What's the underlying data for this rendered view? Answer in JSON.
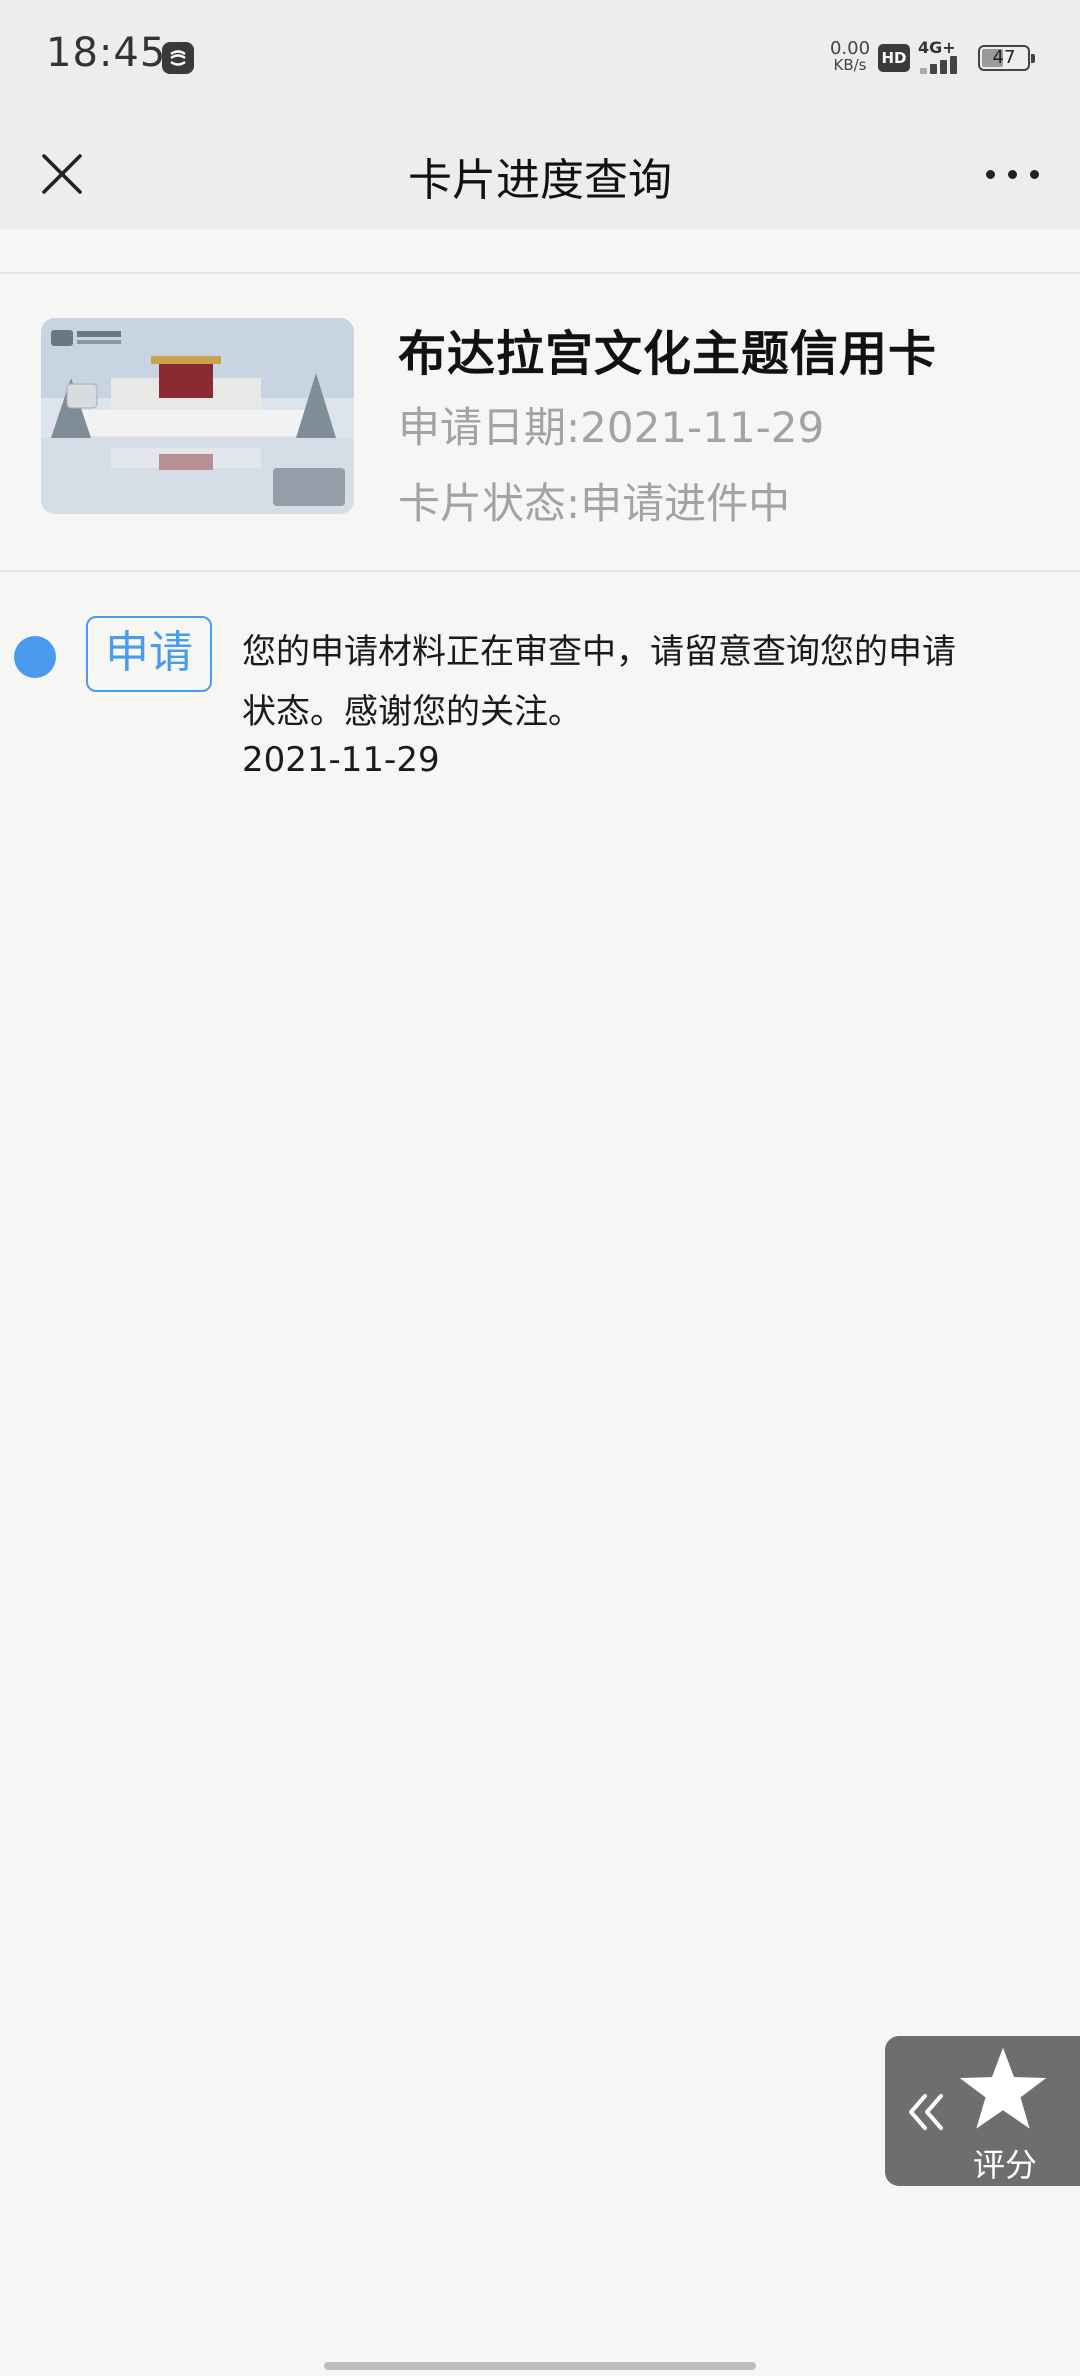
{
  "status_bar": {
    "time": "18:45",
    "net_speed_value": "0.00",
    "net_speed_unit": "KB/s",
    "hd_label": "HD",
    "signal_label": "4G+",
    "battery_level": "47",
    "battery_fraction": 0.47
  },
  "header": {
    "title": "卡片进度查询",
    "close_icon": "close-icon",
    "more_icon": "more-icon"
  },
  "card": {
    "name": "布达拉宫文化主题信用卡",
    "apply_date": "申请日期:2021-11-29",
    "status": "卡片状态:申请进件中",
    "image_icon": "credit-card-image"
  },
  "timeline": [
    {
      "tag": "申请",
      "message": "您的申请材料正在审查中，请留意查询您的申请状态。感谢您的关注。",
      "date": "2021-11-29"
    }
  ],
  "rate_widget": {
    "label": "评分",
    "icons": [
      "collapse-double-chevron-icon",
      "star-icon"
    ]
  },
  "colors": {
    "accent": "#4a9af0",
    "header_bg": "#ededed",
    "page_bg": "#f6f6f5",
    "muted_text": "#a3a3a3",
    "widget_bg": "#6d6e70"
  }
}
